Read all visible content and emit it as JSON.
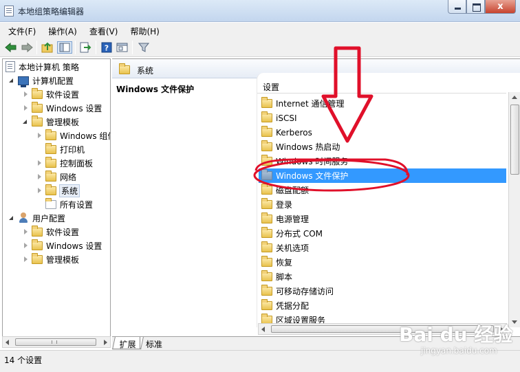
{
  "window": {
    "title": "本地组策略编辑器",
    "close_glyph": "x"
  },
  "menu": [
    "文件(F)",
    "操作(A)",
    "查看(V)",
    "帮助(H)"
  ],
  "toolbar_icons": [
    "back-arrow-icon",
    "forward-arrow-icon",
    "up-folder-icon",
    "show-tree-icon",
    "export-list-icon",
    "help-icon",
    "properties-icon",
    "filter-icon"
  ],
  "tree": {
    "root": "本地计算机 策略",
    "computer_config": "计算机配置",
    "software_settings": "软件设置",
    "windows_settings": "Windows 设置",
    "admin_templates": "管理模板",
    "windows_components": "Windows 组件",
    "printers": "打印机",
    "control_panel": "控制面板",
    "network": "网络",
    "system": "系统",
    "all_settings": "所有设置",
    "user_config": "用户配置",
    "user_software_settings": "软件设置",
    "user_windows_settings": "Windows 设置",
    "user_admin_templates": "管理模板"
  },
  "right": {
    "header": "系统",
    "selected_title": "Windows 文件保护",
    "column_header": "设置",
    "items": [
      "Internet 通信管理",
      "iSCSI",
      "Kerberos",
      "Windows 热启动",
      "Windows 时间服务",
      "Windows 文件保护",
      "磁盘配额",
      "登录",
      "电源管理",
      "分布式 COM",
      "关机选项",
      "恢复",
      "脚本",
      "可移动存储访问",
      "凭据分配",
      "区域设置服务"
    ],
    "selected_index": 5
  },
  "tabs": [
    "扩展",
    "标准"
  ],
  "status": "14 个设置",
  "watermark": {
    "text": "Bai du 经验",
    "sub": "jingyan.baidu.com"
  },
  "colors": {
    "selection": "#3399ff",
    "annotation": "#e0102a",
    "close_button": "#c7442f"
  }
}
